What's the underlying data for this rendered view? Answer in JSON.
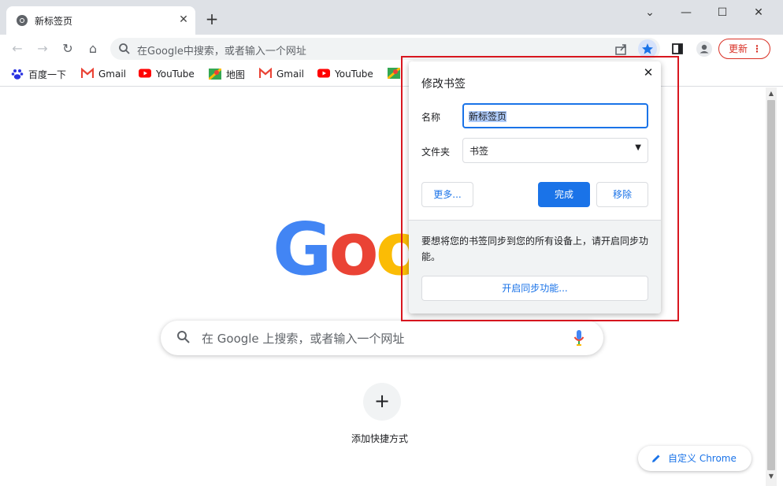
{
  "tab": {
    "title": "新标签页"
  },
  "omnibox": {
    "placeholder": "在Google中搜索，或者输入一个网址"
  },
  "toolbar": {
    "update_label": "更新"
  },
  "bookmarks": [
    {
      "label": "百度一下",
      "icon": "baidu-icon"
    },
    {
      "label": "Gmail",
      "icon": "gmail-icon"
    },
    {
      "label": "YouTube",
      "icon": "youtube-icon"
    },
    {
      "label": "地图",
      "icon": "maps-icon"
    },
    {
      "label": "Gmail",
      "icon": "gmail-icon"
    },
    {
      "label": "YouTube",
      "icon": "youtube-icon"
    }
  ],
  "ntp": {
    "logo": "Google",
    "search_placeholder": "在 Google 上搜索，或者输入一个网址",
    "add_shortcut_label": "添加快捷方式",
    "customize_label": "自定义 Chrome"
  },
  "dialog": {
    "title": "修改书签",
    "name_label": "名称",
    "name_value": "新标签页",
    "folder_label": "文件夹",
    "folder_value": "书签",
    "more_label": "更多...",
    "done_label": "完成",
    "remove_label": "移除",
    "sync_text": "要想将您的书签同步到您的所有设备上，请开启同步功能。",
    "sync_button": "开启同步功能..."
  },
  "colors": {
    "accent": "#1a73e8",
    "highlight_border": "#d8161f",
    "update_red": "#d93025",
    "google_blue": "#4285f4",
    "google_red": "#ea4335",
    "google_yellow": "#fbbc05",
    "google_green": "#34a853"
  }
}
